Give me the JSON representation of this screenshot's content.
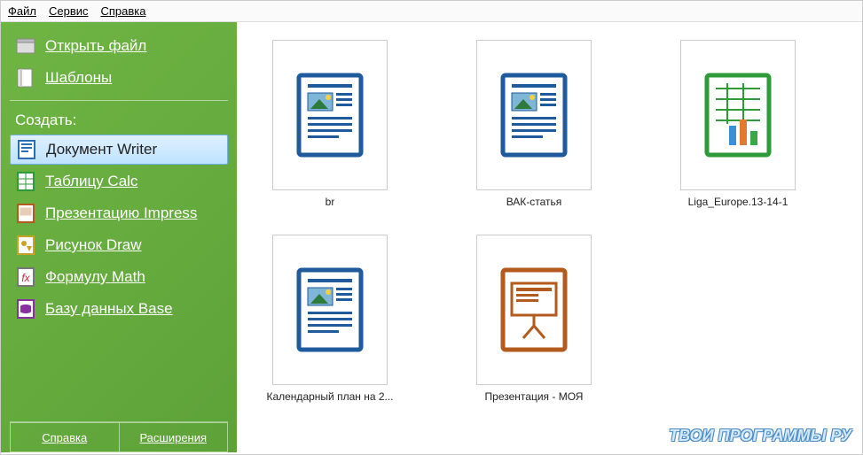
{
  "menubar": {
    "file": "Файл",
    "tools": "Сервис",
    "help": "Справка"
  },
  "sidebar": {
    "open_file": "Открыть файл",
    "templates": "Шаблоны",
    "create_label": "Создать:",
    "apps": {
      "writer": "Документ Writer",
      "calc": "Таблицу Calc",
      "impress": "Презентацию Impress",
      "draw": "Рисунок Draw",
      "math": "Формулу Math",
      "base": "Базу данных Base"
    },
    "bottom": {
      "help": "Справка",
      "extensions": "Расширения"
    }
  },
  "files": [
    {
      "name": "br",
      "type": "writer"
    },
    {
      "name": "ВАК-статья",
      "type": "writer"
    },
    {
      "name": "Liga_Europe.13-14-1",
      "type": "calc"
    },
    {
      "name": "Календарный план на 2...",
      "type": "writer"
    },
    {
      "name": "Презентация  - МОЯ",
      "type": "impress"
    }
  ],
  "watermark": "ТВОИ ПРОГРАММЫ РУ"
}
